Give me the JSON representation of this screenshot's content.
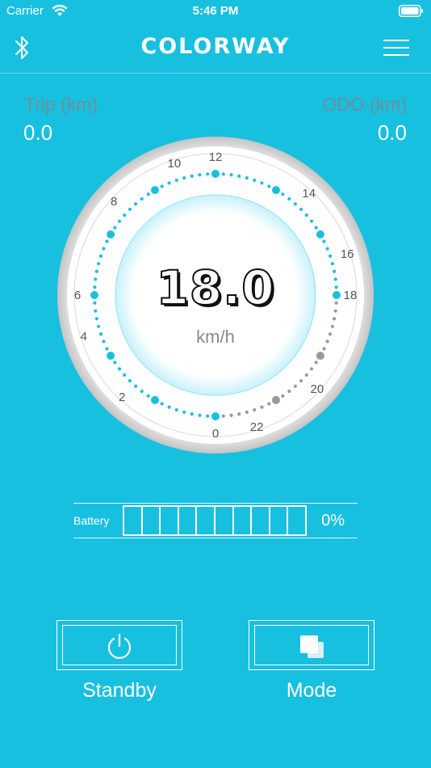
{
  "status_bar": {
    "carrier": "Carrier",
    "time": "5:46 PM"
  },
  "header": {
    "title": "COLORWAY",
    "left_icon": "bluetooth-icon",
    "right_icon": "menu-icon"
  },
  "trip": {
    "label": "Trip (km)",
    "value": "0.0"
  },
  "odo": {
    "label": "ODO (km)",
    "value": "0.0"
  },
  "gauge": {
    "speed": "18.0",
    "unit": "km/h",
    "ticks": [
      "0",
      "2",
      "4",
      "6",
      "8",
      "10",
      "12",
      "14",
      "16",
      "18",
      "20",
      "22"
    ],
    "min": 0,
    "max": 24,
    "current": 18,
    "active_color": "#18C0E0",
    "inactive_color": "#9A9A9A"
  },
  "battery": {
    "label": "Battery",
    "percent": "0%",
    "cells": 10,
    "level": 0
  },
  "controls": {
    "standby_label": "Standby",
    "standby_icon": "power-icon",
    "mode_label": "Mode",
    "mode_icon": "layers-icon"
  },
  "colors": {
    "background": "#18C0E0",
    "gauge_face": "#FFFFFF",
    "label_gray": "#6E8E98"
  }
}
